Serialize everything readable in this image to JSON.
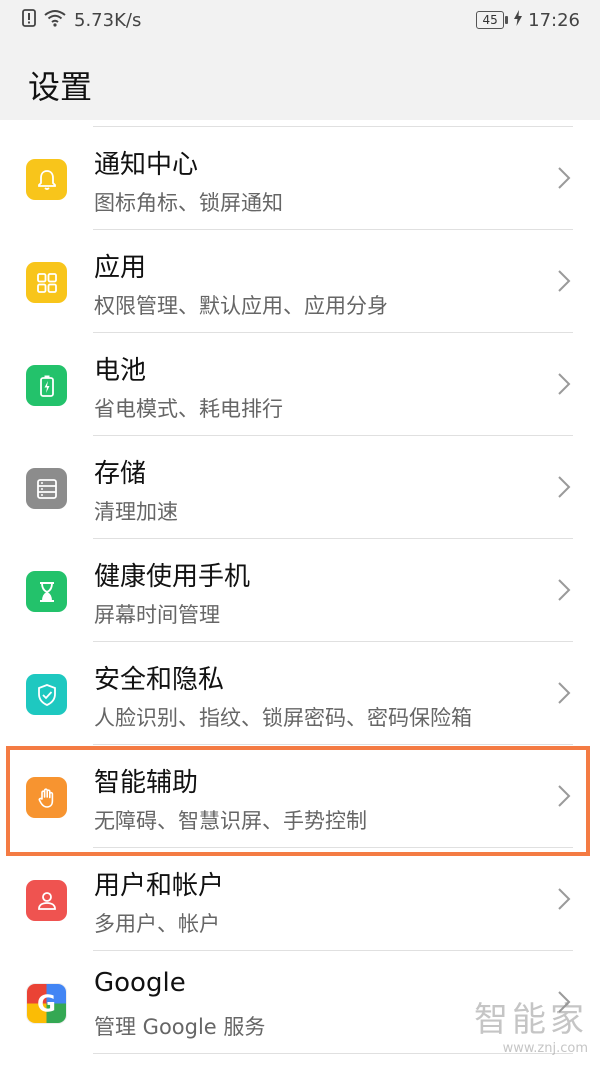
{
  "status_bar": {
    "network_speed": "5.73K/s",
    "battery_level": "45",
    "time": "17:26"
  },
  "header": {
    "title": "设置"
  },
  "settings": [
    {
      "title": "通知中心",
      "subtitle": "图标角标、锁屏通知",
      "icon": "bell-icon",
      "color": "#f8c51b"
    },
    {
      "title": "应用",
      "subtitle": "权限管理、默认应用、应用分身",
      "icon": "apps-grid-icon",
      "color": "#f8c51b"
    },
    {
      "title": "电池",
      "subtitle": "省电模式、耗电排行",
      "icon": "battery-icon",
      "color": "#23c26b"
    },
    {
      "title": "存储",
      "subtitle": "清理加速",
      "icon": "storage-icon",
      "color": "#8c8c8c"
    },
    {
      "title": "健康使用手机",
      "subtitle": "屏幕时间管理",
      "icon": "hourglass-icon",
      "color": "#23c26b"
    },
    {
      "title": "安全和隐私",
      "subtitle": "人脸识别、指纹、锁屏密码、密码保险箱",
      "icon": "shield-icon",
      "color": "#1ec8c0"
    },
    {
      "title": "智能辅助",
      "subtitle": "无障碍、智慧识屏、手势控制",
      "icon": "hand-icon",
      "color": "#f79430"
    },
    {
      "title": "用户和帐户",
      "subtitle": "多用户、帐户",
      "icon": "user-icon",
      "color": "#ef5350"
    },
    {
      "title": "Google",
      "subtitle": "管理 Google 服务",
      "icon": "google-icon",
      "color": "#ffffff"
    }
  ],
  "highlighted_item": "智能辅助",
  "watermark": {
    "text": "智能家",
    "url": "www.znj.com"
  }
}
